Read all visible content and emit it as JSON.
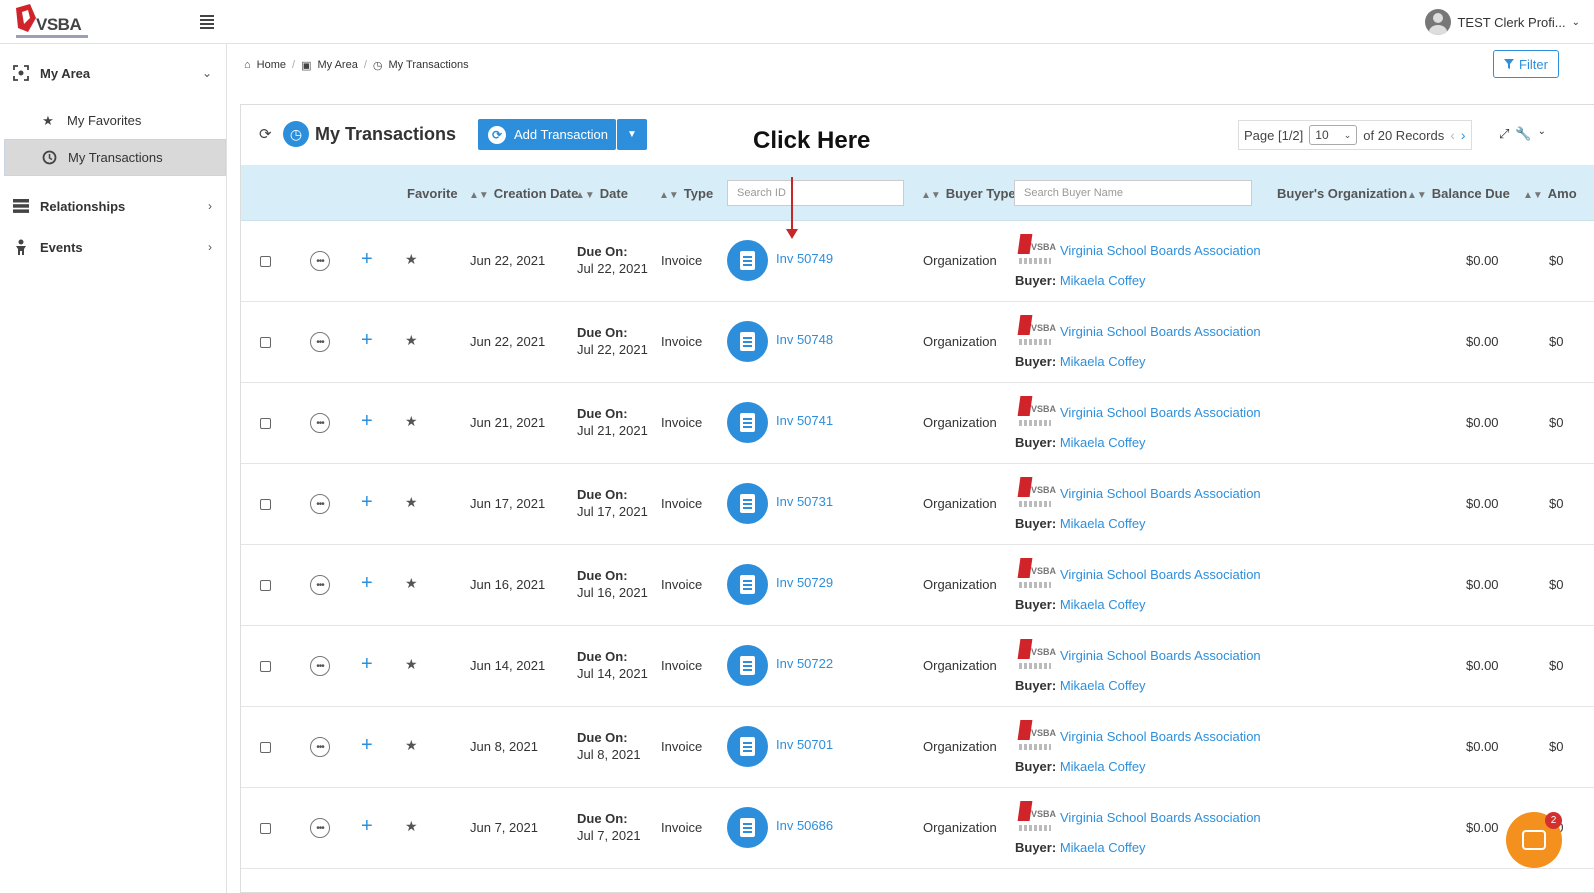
{
  "app": {
    "logo_text": "VSBA",
    "user_name": "TEST Clerk Profi..."
  },
  "sidebar": {
    "my_area": "My Area",
    "my_favorites": "My Favorites",
    "my_transactions": "My Transactions",
    "relationships": "Relationships",
    "events": "Events"
  },
  "breadcrumb": {
    "home": "Home",
    "my_area": "My Area",
    "current": "My Transactions"
  },
  "toolbar": {
    "filter": "Filter",
    "title": "My Transactions",
    "add_transaction": "Add Transaction",
    "annotation": "Click Here"
  },
  "pager": {
    "page": "Page [1/2]",
    "per_page": "10",
    "records": "of 20 Records"
  },
  "columns": {
    "favorite": "Favorite",
    "creation_date": "Creation Date",
    "date": "Date",
    "type": "Type",
    "search_id_placeholder": "Search ID",
    "buyer_type": "Buyer Type",
    "search_buyer_placeholder": "Search Buyer Name",
    "buyers_org": "Buyer's Organization",
    "balance_due": "Balance Due",
    "amount": "Amo"
  },
  "rows": [
    {
      "created": "Jun 22, 2021",
      "due_label": "Due On:",
      "due": "Jul 22, 2021",
      "type": "Invoice",
      "id": "Inv 50749",
      "buyer_type": "Organization",
      "org": "Virginia School Boards Association",
      "buyer_label": "Buyer:",
      "buyer": "Mikaela Coffey",
      "balance": "$0.00",
      "amount": "$0"
    },
    {
      "created": "Jun 22, 2021",
      "due_label": "Due On:",
      "due": "Jul 22, 2021",
      "type": "Invoice",
      "id": "Inv 50748",
      "buyer_type": "Organization",
      "org": "Virginia School Boards Association",
      "buyer_label": "Buyer:",
      "buyer": "Mikaela Coffey",
      "balance": "$0.00",
      "amount": "$0"
    },
    {
      "created": "Jun 21, 2021",
      "due_label": "Due On:",
      "due": "Jul 21, 2021",
      "type": "Invoice",
      "id": "Inv 50741",
      "buyer_type": "Organization",
      "org": "Virginia School Boards Association",
      "buyer_label": "Buyer:",
      "buyer": "Mikaela Coffey",
      "balance": "$0.00",
      "amount": "$0"
    },
    {
      "created": "Jun 17, 2021",
      "due_label": "Due On:",
      "due": "Jul 17, 2021",
      "type": "Invoice",
      "id": "Inv 50731",
      "buyer_type": "Organization",
      "org": "Virginia School Boards Association",
      "buyer_label": "Buyer:",
      "buyer": "Mikaela Coffey",
      "balance": "$0.00",
      "amount": "$0"
    },
    {
      "created": "Jun 16, 2021",
      "due_label": "Due On:",
      "due": "Jul 16, 2021",
      "type": "Invoice",
      "id": "Inv 50729",
      "buyer_type": "Organization",
      "org": "Virginia School Boards Association",
      "buyer_label": "Buyer:",
      "buyer": "Mikaela Coffey",
      "balance": "$0.00",
      "amount": "$0"
    },
    {
      "created": "Jun 14, 2021",
      "due_label": "Due On:",
      "due": "Jul 14, 2021",
      "type": "Invoice",
      "id": "Inv 50722",
      "buyer_type": "Organization",
      "org": "Virginia School Boards Association",
      "buyer_label": "Buyer:",
      "buyer": "Mikaela Coffey",
      "balance": "$0.00",
      "amount": "$0"
    },
    {
      "created": "Jun 8, 2021",
      "due_label": "Due On:",
      "due": "Jul 8, 2021",
      "type": "Invoice",
      "id": "Inv 50701",
      "buyer_type": "Organization",
      "org": "Virginia School Boards Association",
      "buyer_label": "Buyer:",
      "buyer": "Mikaela Coffey",
      "balance": "$0.00",
      "amount": "$0"
    },
    {
      "created": "Jun 7, 2021",
      "due_label": "Due On:",
      "due": "Jul 7, 2021",
      "type": "Invoice",
      "id": "Inv 50686",
      "buyer_type": "Organization",
      "org": "Virginia School Boards Association",
      "buyer_label": "Buyer:",
      "buyer": "Mikaela Coffey",
      "balance": "$0.00",
      "amount": "$0"
    }
  ],
  "chat": {
    "badge": "2"
  },
  "colors": {
    "accent": "#2d8fdb",
    "header_bg": "#d7eef9",
    "chat": "#f4901e",
    "annotation_arrow": "#c62828"
  },
  "icons": [
    "hamburger-icon",
    "focus-icon",
    "star-icon",
    "history-icon",
    "layers-icon",
    "person-icon",
    "home-icon",
    "filter-icon",
    "refresh-icon",
    "more-icon",
    "plus-icon",
    "invoice-icon",
    "expand-icon",
    "wrench-icon",
    "chat-icon"
  ]
}
